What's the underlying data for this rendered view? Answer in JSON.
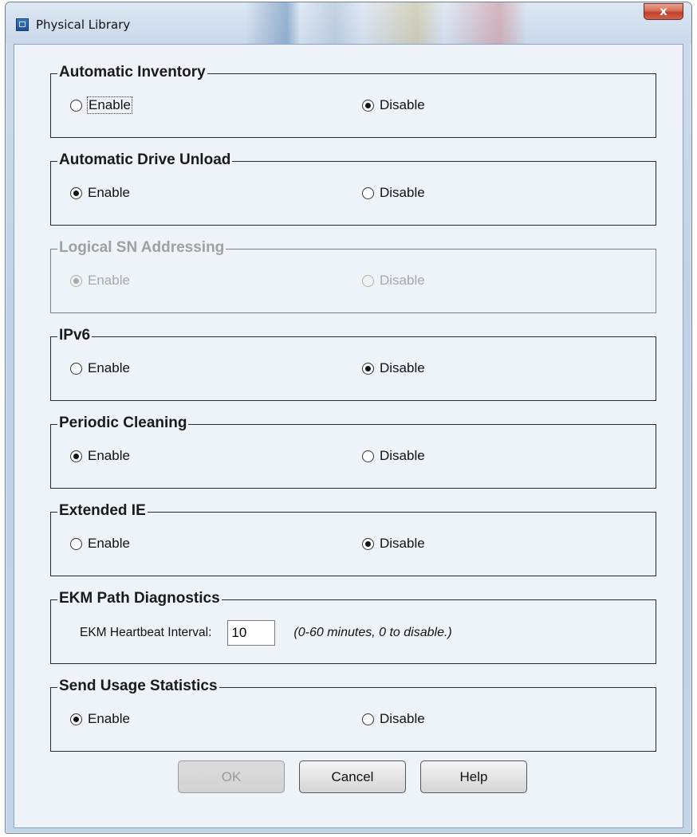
{
  "window": {
    "title": "Physical Library",
    "close_label": "x"
  },
  "option_labels": {
    "enable": "Enable",
    "disable": "Disable"
  },
  "groups": [
    {
      "title": "Automatic Inventory",
      "selected": "disable",
      "enabled": true
    },
    {
      "title": "Automatic Drive Unload",
      "selected": "enable",
      "enabled": true
    },
    {
      "title": "Logical SN Addressing",
      "selected": "enable",
      "enabled": false
    },
    {
      "title": "IPv6",
      "selected": "disable",
      "enabled": true
    },
    {
      "title": "Periodic Cleaning",
      "selected": "enable",
      "enabled": true
    },
    {
      "title": "Extended IE",
      "selected": "disable",
      "enabled": true
    }
  ],
  "ekm": {
    "title": "EKM Path Diagnostics",
    "label": "EKM Heartbeat Interval:",
    "value": "10",
    "hint": "(0-60 minutes, 0 to disable.)"
  },
  "usage": {
    "title": "Send Usage Statistics",
    "selected": "enable",
    "enabled": true
  },
  "buttons": {
    "ok": "OK",
    "cancel": "Cancel",
    "help": "Help"
  }
}
